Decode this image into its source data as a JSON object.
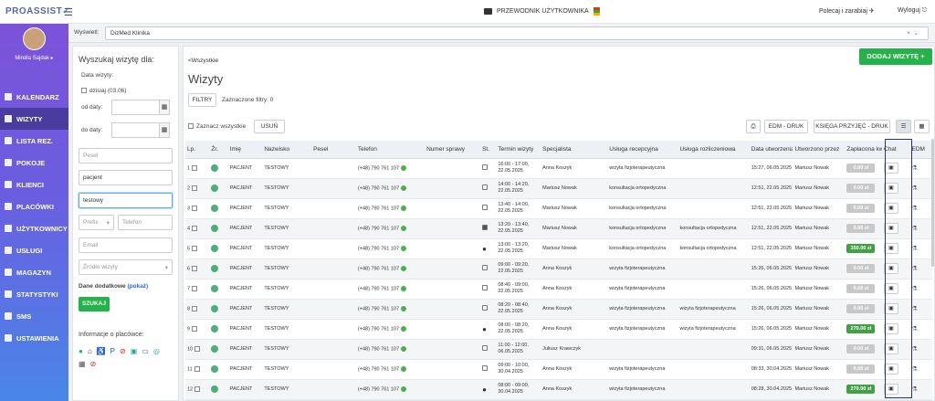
{
  "header": {
    "logo": "PROASSIST",
    "guide": "PRZEWODNIK UŻYTKOWNIKA",
    "recommend": "Polecaj i zarabiaj",
    "logout": "Wyloguj"
  },
  "profile": {
    "name": "Mirella Sajdak"
  },
  "nav": [
    {
      "label": "KALENDARZ",
      "icon": "calendar-icon"
    },
    {
      "label": "WIZYTY",
      "icon": "list-icon",
      "active": true
    },
    {
      "label": "LISTA REZ.",
      "icon": "clipboard-icon"
    },
    {
      "label": "POKOJE",
      "icon": "door-icon"
    },
    {
      "label": "KLIENCI",
      "icon": "users-icon"
    },
    {
      "label": "PLACÓWKI",
      "icon": "building-icon"
    },
    {
      "label": "UŻYTKOWNICY",
      "icon": "user-icon"
    },
    {
      "label": "USŁUGI",
      "icon": "grid-icon"
    },
    {
      "label": "MAGAZYN",
      "icon": "box-icon"
    },
    {
      "label": "STATYSTYKI",
      "icon": "chart-icon"
    },
    {
      "label": "SMS",
      "icon": "sms-icon"
    },
    {
      "label": "USTAWIENIA",
      "icon": "wrench-icon"
    }
  ],
  "filter": {
    "label": "Wyświetl:",
    "value": "DizMed Klinika",
    "clear": "×",
    "caret": "⌄"
  },
  "search": {
    "title": "Wyszukaj wizytę dla:",
    "visit_date": "Data wizyty:",
    "today": "dzisiaj (03.06)",
    "from": "od daty:",
    "to": "do daty:",
    "pesel_ph": "Pesel",
    "name_val": "pacjent",
    "surname_val": "testowy",
    "prefix_ph": "Prefix",
    "phone_ph": "Telefon",
    "email_ph": "Email",
    "source_ph": "Źródło wizyty",
    "extra_label": "Dane dodatkowe",
    "extra_link": "(pokaż)",
    "search_btn": "SZUKAJ",
    "info_title": "Informacje o placówce:"
  },
  "main": {
    "back": "<Wszystkie",
    "title": "Wizyty",
    "add_btn": "DODAJ WIZYTĘ +",
    "filters_btn": "FILTRY",
    "selected_filters": "Zaznaczone filtry: 0",
    "select_all": "Zaznacz wszystkie",
    "delete_btn": "USUŃ",
    "edm_print": "EDM - DRUK",
    "book_print": "KSIĘGA PRZYJĘĆ - DRUK"
  },
  "table": {
    "headers": [
      "Lp.",
      "Źr.",
      "Imię",
      "Nazwisko",
      "Pesel",
      "Telefon",
      "Numer sprawy",
      "St.",
      "Termin wizyty",
      "Specjalista",
      "Usługa recepcyjna",
      "Usługa rozliczeniowa",
      "Data utworzenia",
      "Utworzono przez",
      "Zapłacona kwota",
      "Chat",
      "EDM"
    ],
    "rows": [
      {
        "lp": "1",
        "imie": "PACJENT",
        "nazwisko": "TESTOWY",
        "tel": "(+48) 790 761 107",
        "st": "edit",
        "termin": "16:00 - 17:00, 22.05.2025",
        "spec": "Anna Koszyk",
        "rec": "wizyta fizjoterapeutyczna",
        "roz": "",
        "utw": "15:27, 06.05.2025",
        "przez": "Mariusz Nowak",
        "kwota": "0.00 zł",
        "paid": false
      },
      {
        "lp": "2",
        "imie": "PACJENT",
        "nazwisko": "TESTOWY",
        "tel": "(+48) 790 761 107",
        "st": "edit",
        "termin": "14:00 - 14:20, 22.05.2025",
        "spec": "Mariusz Nowak",
        "rec": "konsultacja ortopedyczna",
        "roz": "",
        "utw": "12:51, 22.05.2025",
        "przez": "Mariusz Nowak",
        "kwota": "0.00 zł",
        "paid": false
      },
      {
        "lp": "3",
        "imie": "PACJENT",
        "nazwisko": "TESTOWY",
        "tel": "(+48) 790 761 107",
        "st": "edit",
        "termin": "13:40 - 14:00, 22.05.2025",
        "spec": "Mariusz Nowak",
        "rec": "konsultacja ortopedyczna",
        "roz": "",
        "utw": "12:51, 22.05.2025",
        "przez": "Mariusz Nowak",
        "kwota": "0.00 zł",
        "paid": false
      },
      {
        "lp": "4",
        "imie": "PACJENT",
        "nazwisko": "TESTOWY",
        "tel": "(+48) 790 761 107",
        "st": "box",
        "termin": "13:20 - 13:40, 22.05.2025",
        "spec": "Mariusz Nowak",
        "rec": "konsultacja ortopedyczna",
        "roz": "konsultacja ortopedyczna",
        "utw": "12:51, 22.05.2025",
        "przez": "Mariusz Nowak",
        "kwota": "0.00 zł",
        "paid": false
      },
      {
        "lp": "5",
        "imie": "PACJENT",
        "nazwisko": "TESTOWY",
        "tel": "(+48) 790 761 107",
        "st": "person",
        "termin": "13:00 - 13:20, 22.05.2025",
        "spec": "Mariusz Nowak",
        "rec": "konsultacja ortopedyczna",
        "roz": "konsultacja ortopedyczna",
        "utw": "12:51, 22.05.2025",
        "przez": "Mariusz Nowak",
        "kwota": "350.00 zł",
        "paid": true
      },
      {
        "lp": "6",
        "imie": "PACJENT",
        "nazwisko": "TESTOWY",
        "tel": "(+48) 790 761 107",
        "st": "edit",
        "termin": "09:00 - 09:20, 22.05.2025",
        "spec": "Anna Koszyk",
        "rec": "wizyta fizjoterapeutyczna",
        "roz": "",
        "utw": "15:26, 06.05.2025",
        "przez": "Mariusz Nowak",
        "kwota": "0.00 zł",
        "paid": false
      },
      {
        "lp": "7",
        "imie": "PACJENT",
        "nazwisko": "TESTOWY",
        "tel": "(+48) 790 761 107",
        "st": "edit",
        "termin": "08:40 - 09:00, 22.05.2025",
        "spec": "Anna Koszyk",
        "rec": "wizyta fizjoterapeutyczna",
        "roz": "",
        "utw": "15:26, 06.05.2025",
        "przez": "Mariusz Nowak",
        "kwota": "0.00 zł",
        "paid": false
      },
      {
        "lp": "8",
        "imie": "PACJENT",
        "nazwisko": "TESTOWY",
        "tel": "(+48) 790 761 107",
        "st": "edit",
        "termin": "08:20 - 08:40, 22.05.2025",
        "spec": "Anna Koszyk",
        "rec": "wizyta fizjoterapeutyczna",
        "roz": "wizyta fizjoterapeutyczna",
        "utw": "15:26, 06.05.2025",
        "przez": "Mariusz Nowak",
        "kwota": "0.00 zł",
        "paid": false
      },
      {
        "lp": "9",
        "imie": "PACJENT",
        "nazwisko": "TESTOWY",
        "tel": "(+48) 790 761 107",
        "st": "person",
        "termin": "08:00 - 08:20, 22.05.2025",
        "spec": "Anna Koszyk",
        "rec": "wizyta fizjoterapeutyczna",
        "roz": "wizyta fizjoterapeutyczna",
        "utw": "15:26, 06.05.2025",
        "przez": "Mariusz Nowak",
        "kwota": "270.00 zł",
        "paid": true
      },
      {
        "lp": "10",
        "imie": "PACJENT",
        "nazwisko": "TESTOWY",
        "tel": "(+48) 790 761 107",
        "st": "edit",
        "termin": "11:00 - 12:00, 06.05.2025",
        "spec": "Juliusz Krawczyk",
        "rec": "",
        "roz": "",
        "utw": "09:31, 06.05.2025",
        "przez": "Mariusz Nowak",
        "kwota": "0.00 zł",
        "paid": false
      },
      {
        "lp": "11",
        "imie": "PACJENT",
        "nazwisko": "TESTOWY",
        "tel": "(+48) 790 761 107",
        "st": "edit",
        "termin": "09:00 - 10:00, 30.04.2025",
        "spec": "Anna Koszyk",
        "rec": "wizyta fizjoterapeutyczna",
        "roz": "",
        "utw": "08:33, 30.04.2025",
        "przez": "Mariusz Nowak",
        "kwota": "0.00 zł",
        "paid": false
      },
      {
        "lp": "12",
        "imie": "PACJENT",
        "nazwisko": "TESTOWY",
        "tel": "(+48) 790 761 107",
        "st": "person",
        "termin": "08:00 - 09:00, 30.04.2025",
        "spec": "Anna Koszyk",
        "rec": "wizyta fizjoterapeutyczna",
        "roz": "",
        "utw": "08:28, 30.04.2025",
        "przez": "Mariusz Nowak",
        "kwota": "270.00 zł",
        "paid": true
      }
    ]
  }
}
